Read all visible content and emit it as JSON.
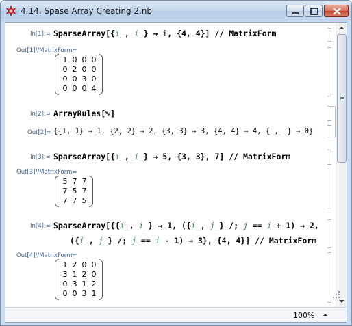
{
  "window": {
    "title": "4.14. Spase Array Creating 2.nb"
  },
  "cells": {
    "in1": {
      "label": "In[1]:=",
      "code_a": "SparseArray[{",
      "v1": "i_",
      "code_b": ", ",
      "v2": "i_",
      "code_c": "} → ",
      "v3": "i",
      "code_d": ", {4, 4}] // MatrixForm"
    },
    "out1": {
      "label": "Out[1]//MatrixForm=",
      "rows": [
        [
          "1",
          "0",
          "0",
          "0"
        ],
        [
          "0",
          "2",
          "0",
          "0"
        ],
        [
          "0",
          "0",
          "3",
          "0"
        ],
        [
          "0",
          "0",
          "0",
          "4"
        ]
      ]
    },
    "in2": {
      "label": "In[2]:=",
      "code": "ArrayRules[%]"
    },
    "out2": {
      "label": "Out[2]=",
      "text": "{{1, 1} → 1, {2, 2} → 2, {3, 3} → 3, {4, 4} → 4, {_, _} → 0}"
    },
    "in3": {
      "label": "In[3]:=",
      "code_a": "SparseArray[{",
      "v1": "i_",
      "code_b": ", ",
      "v2": "i_",
      "code_c": "} → 5, {3, 3}, 7] // MatrixForm"
    },
    "out3": {
      "label": "Out[3]//MatrixForm=",
      "rows": [
        [
          "5",
          "7",
          "7"
        ],
        [
          "7",
          "5",
          "7"
        ],
        [
          "7",
          "7",
          "5"
        ]
      ]
    },
    "in4": {
      "label": "In[4]:=",
      "line1_a": "SparseArray[{{",
      "l1v1": "i_",
      "line1_b": ", ",
      "l1v2": "i_",
      "line1_c": "} → 1, ({",
      "l1v3": "i_",
      "line1_d": ", ",
      "l1v4": "j_",
      "line1_e": "} /; ",
      "l1v5": "j",
      "line1_f": " == ",
      "l1v6": "i",
      "line1_g": " + 1) → 2,",
      "line2_a": "({",
      "l2v1": "i_",
      "line2_b": ", ",
      "l2v2": "j_",
      "line2_c": "} /; ",
      "l2v3": "j",
      "line2_d": " == ",
      "l2v4": "i",
      "line2_e": " - 1) → 3}, {4, 4}] // MatrixForm"
    },
    "out4": {
      "label": "Out[4]//MatrixForm=",
      "rows": [
        [
          "1",
          "2",
          "0",
          "0"
        ],
        [
          "3",
          "1",
          "2",
          "0"
        ],
        [
          "0",
          "3",
          "1",
          "2"
        ],
        [
          "0",
          "0",
          "3",
          "1"
        ]
      ]
    }
  },
  "status": {
    "zoom": "100%"
  }
}
